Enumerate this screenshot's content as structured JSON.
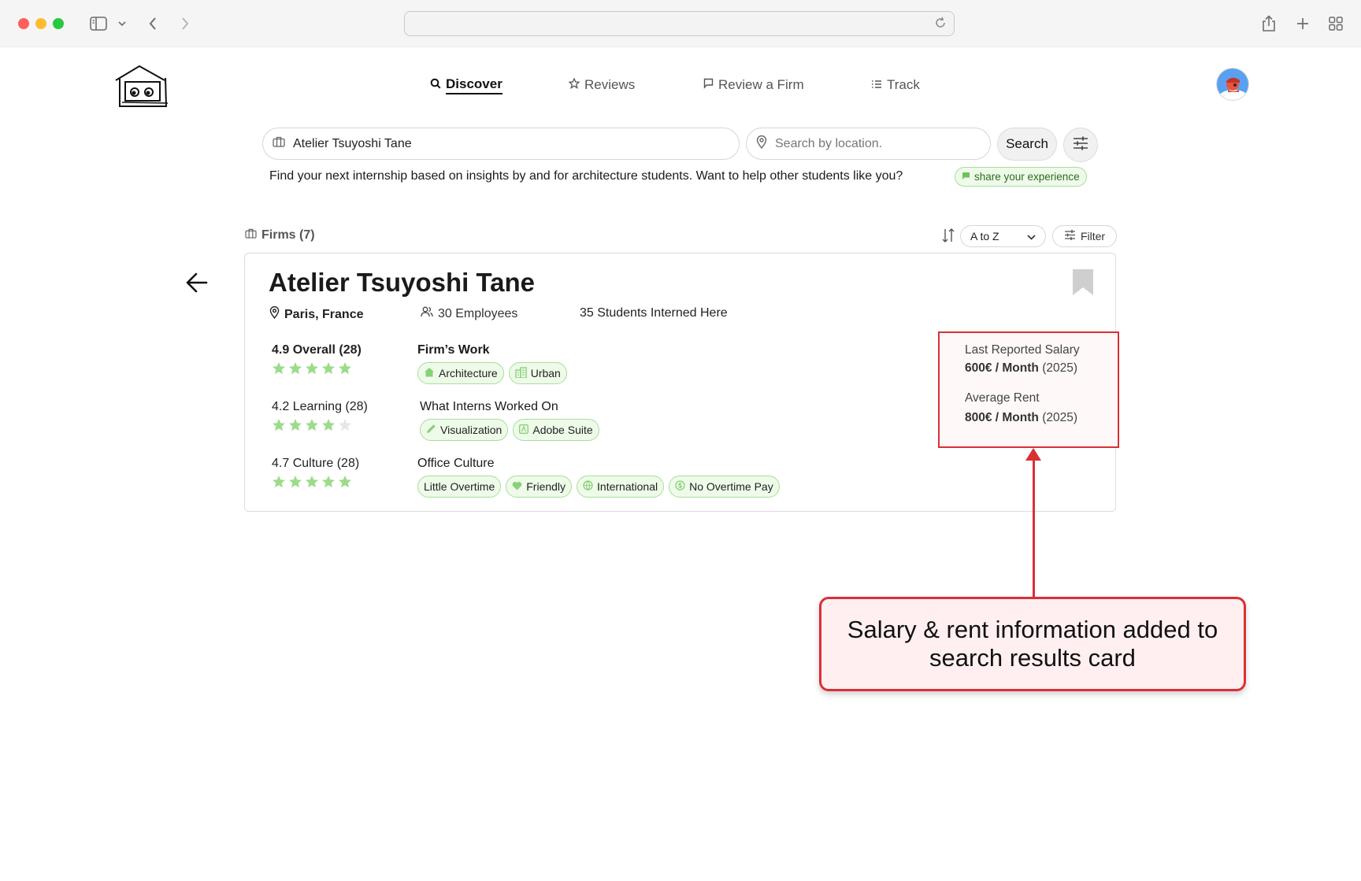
{
  "nav": {
    "discover": "Discover",
    "reviews": "Reviews",
    "review_firm": "Review a Firm",
    "track": "Track"
  },
  "search": {
    "firm_value": "Atelier Tsuyoshi Tane",
    "location_placeholder": "Search by location.",
    "button": "Search"
  },
  "tagline": "Find your next internship based on insights by and for architecture students. Want to help other students like you?",
  "share_pill": "share your experience",
  "results": {
    "firms_count": "Firms (7)",
    "sort_value": "A to Z",
    "filter_label": "Filter"
  },
  "card": {
    "name": "Atelier Tsuyoshi Tane",
    "location": "Paris, France",
    "employees": "30 Employees",
    "students": "35 Students Interned Here",
    "ratings": [
      {
        "label": "4.9 Overall (28)",
        "stars": 5
      },
      {
        "label": "4.2 Learning (28)",
        "stars": 4
      },
      {
        "label": "4.7 Culture (28)",
        "stars": 5
      }
    ],
    "sections": {
      "work": {
        "title": "Firm’s Work",
        "tags": [
          {
            "label": "Architecture",
            "icon": "house-icon"
          },
          {
            "label": "Urban",
            "icon": "buildings-icon"
          }
        ]
      },
      "interns": {
        "title": "What Interns Worked On",
        "tags": [
          {
            "label": "Visualization",
            "icon": "pencil-icon"
          },
          {
            "label": "Adobe Suite",
            "icon": "adobe-icon"
          }
        ]
      },
      "culture": {
        "title": "Office Culture",
        "tags": [
          {
            "label": "Little Overtime",
            "icon": ""
          },
          {
            "label": "Friendly",
            "icon": "heart-icon"
          },
          {
            "label": "International",
            "icon": "globe-icon"
          },
          {
            "label": "No Overtime Pay",
            "icon": "coin-icon"
          }
        ]
      }
    },
    "salary": {
      "label": "Last Reported Salary",
      "value": "600€ / Month",
      "year": "(2025)"
    },
    "rent": {
      "label": "Average Rent",
      "value": "800€ / Month",
      "year": "(2025)"
    }
  },
  "callout": "Salary & rent information added to search results card",
  "colors": {
    "accent_green": "#9bdc8a",
    "tag_bg": "#eefbe9",
    "callout_red": "#d93036"
  }
}
